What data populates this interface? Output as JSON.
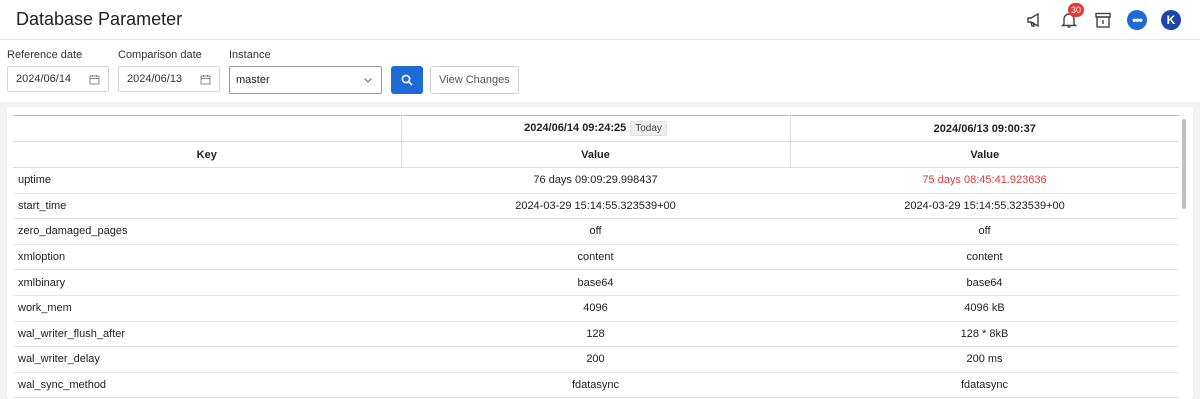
{
  "header": {
    "title": "Database Parameter",
    "notification_count": "30",
    "avatar_initial": "K",
    "icons": [
      "megaphone-icon",
      "bell-icon",
      "archive-icon",
      "chat-icon"
    ]
  },
  "filters": {
    "reference_label": "Reference date",
    "reference_value": "2024/06/14",
    "comparison_label": "Comparison date",
    "comparison_value": "2024/06/13",
    "instance_label": "Instance",
    "instance_value": "master",
    "view_changes_label": "View Changes"
  },
  "table": {
    "col1_datetime": "2024/06/14 09:24:25",
    "col1_tag": "Today",
    "col2_datetime": "2024/06/13 09:00:37",
    "key_header": "Key",
    "value_header": "Value",
    "rows": [
      {
        "key": "uptime",
        "ref": "76 days 09:09:29.998437",
        "cmp": "75 days 08:45:41.923636",
        "changed": true
      },
      {
        "key": "start_time",
        "ref": "2024-03-29 15:14:55.323539+00",
        "cmp": "2024-03-29 15:14:55.323539+00",
        "changed": false
      },
      {
        "key": "zero_damaged_pages",
        "ref": "off",
        "cmp": "off",
        "changed": false
      },
      {
        "key": "xmloption",
        "ref": "content",
        "cmp": "content",
        "changed": false
      },
      {
        "key": "xmlbinary",
        "ref": "base64",
        "cmp": "base64",
        "changed": false
      },
      {
        "key": "work_mem",
        "ref": "4096",
        "cmp": "4096 kB",
        "changed": false
      },
      {
        "key": "wal_writer_flush_after",
        "ref": "128",
        "cmp": "128 * 8kB",
        "changed": false
      },
      {
        "key": "wal_writer_delay",
        "ref": "200",
        "cmp": "200 ms",
        "changed": false
      },
      {
        "key": "wal_sync_method",
        "ref": "fdatasync",
        "cmp": "fdatasync",
        "changed": false
      }
    ]
  },
  "colors": {
    "primary": "#1e6bd6",
    "changed_value": "#e53935",
    "badge": "#e53935"
  }
}
